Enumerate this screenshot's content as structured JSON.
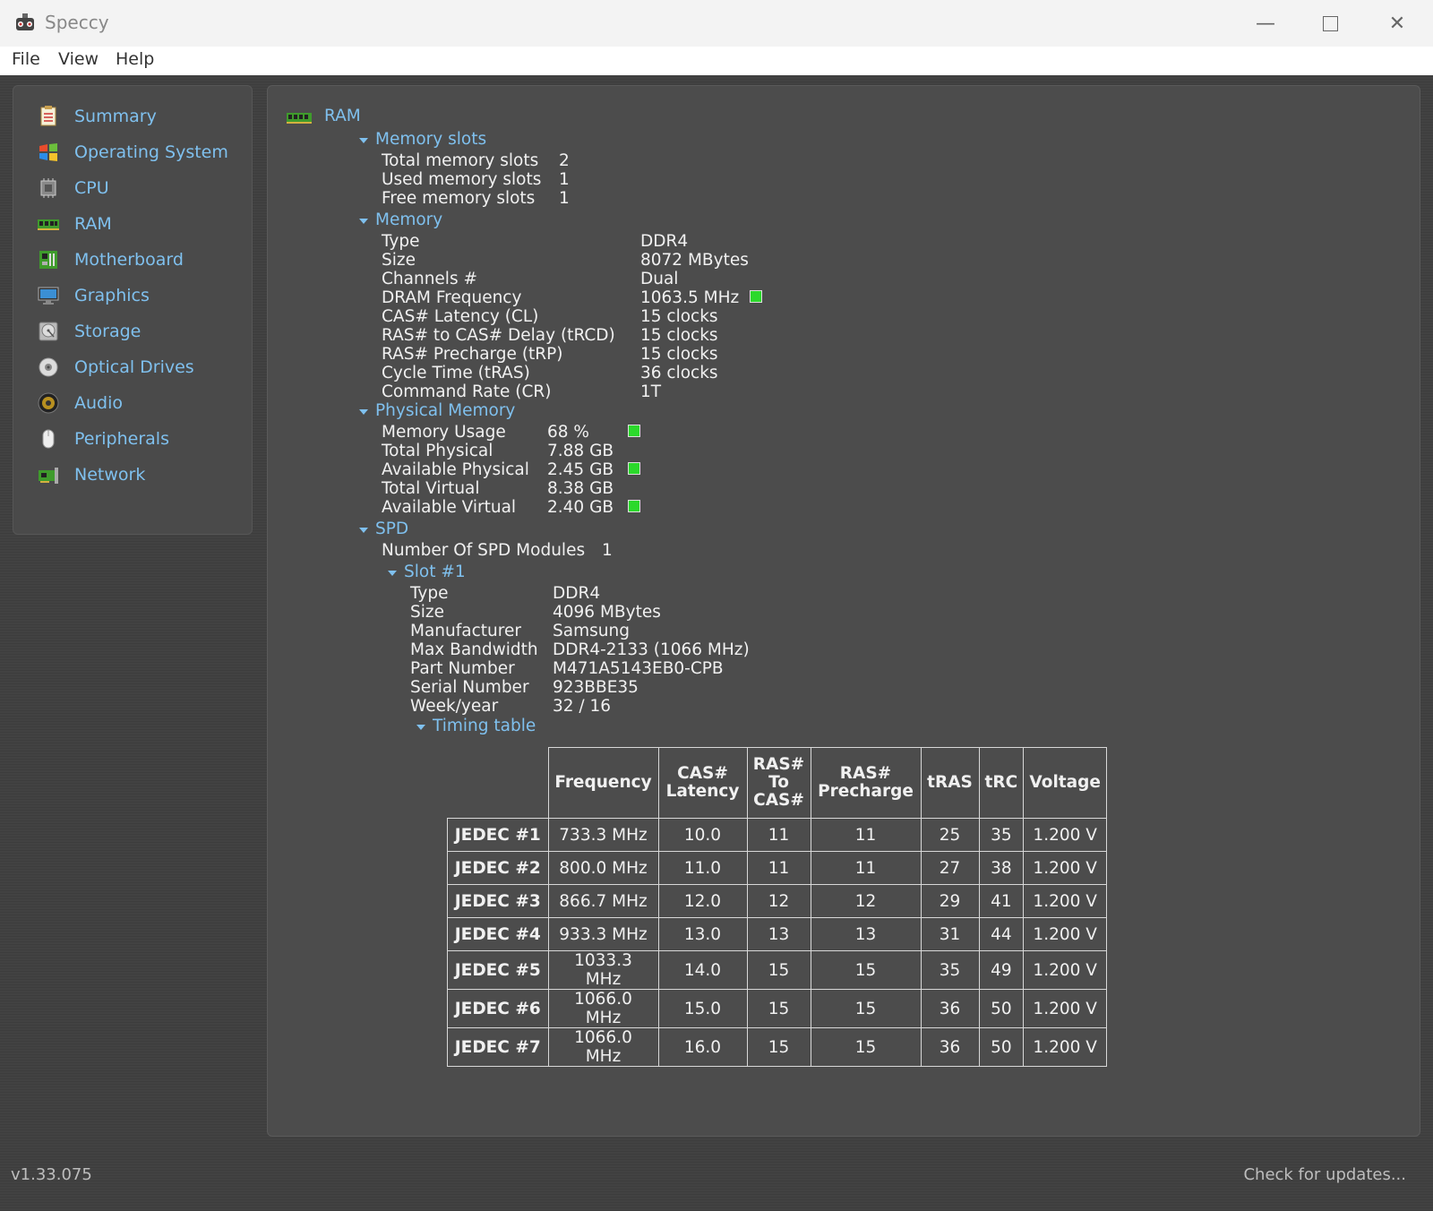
{
  "window": {
    "title": "Speccy"
  },
  "menu": [
    "File",
    "View",
    "Help"
  ],
  "sidebar": {
    "items": [
      {
        "label": "Summary",
        "icon": "summary-icon"
      },
      {
        "label": "Operating System",
        "icon": "windows-icon"
      },
      {
        "label": "CPU",
        "icon": "cpu-icon"
      },
      {
        "label": "RAM",
        "icon": "ram-icon"
      },
      {
        "label": "Motherboard",
        "icon": "motherboard-icon"
      },
      {
        "label": "Graphics",
        "icon": "monitor-icon"
      },
      {
        "label": "Storage",
        "icon": "hard-drive-icon"
      },
      {
        "label": "Optical Drives",
        "icon": "disc-icon"
      },
      {
        "label": "Audio",
        "icon": "speaker-icon"
      },
      {
        "label": "Peripherals",
        "icon": "mouse-icon"
      },
      {
        "label": "Network",
        "icon": "network-icon"
      }
    ]
  },
  "content": {
    "section_title": "RAM",
    "memory_slots": {
      "heading": "Memory slots",
      "rows": [
        {
          "label": "Total memory slots",
          "value": "2"
        },
        {
          "label": "Used memory slots",
          "value": "1"
        },
        {
          "label": "Free memory slots",
          "value": "1"
        }
      ]
    },
    "memory": {
      "heading": "Memory",
      "rows": [
        {
          "label": "Type",
          "value": "DDR4"
        },
        {
          "label": "Size",
          "value": "8072 MBytes"
        },
        {
          "label": "Channels #",
          "value": "Dual"
        },
        {
          "label": "DRAM Frequency",
          "value": "1063.5 MHz"
        },
        {
          "label": "CAS# Latency (CL)",
          "value": "15 clocks"
        },
        {
          "label": "RAS# to CAS# Delay (tRCD)",
          "value": "15 clocks"
        },
        {
          "label": "RAS# Precharge (tRP)",
          "value": "15 clocks"
        },
        {
          "label": "Cycle Time (tRAS)",
          "value": "36 clocks"
        },
        {
          "label": "Command Rate (CR)",
          "value": "1T"
        }
      ]
    },
    "physical_memory": {
      "heading": "Physical Memory",
      "rows": [
        {
          "label": "Memory Usage",
          "value": "68 %"
        },
        {
          "label": "Total Physical",
          "value": "7.88 GB"
        },
        {
          "label": "Available Physical",
          "value": "2.45 GB"
        },
        {
          "label": "Total Virtual",
          "value": "8.38 GB"
        },
        {
          "label": "Available Virtual",
          "value": "2.40 GB"
        }
      ]
    },
    "spd": {
      "heading": "SPD",
      "modules_label": "Number Of SPD Modules",
      "modules_value": "1",
      "slot_heading": "Slot #1",
      "slot_rows": [
        {
          "label": "Type",
          "value": "DDR4"
        },
        {
          "label": "Size",
          "value": "4096 MBytes"
        },
        {
          "label": "Manufacturer",
          "value": "Samsung"
        },
        {
          "label": "Max Bandwidth",
          "value": "DDR4-2133 (1066 MHz)"
        },
        {
          "label": "Part Number",
          "value": "M471A5143EB0-CPB"
        },
        {
          "label": "Serial Number",
          "value": "923BBE35"
        },
        {
          "label": "Week/year",
          "value": "32 / 16"
        }
      ],
      "timing_heading": "Timing table",
      "timing_columns": [
        "Frequency",
        "CAS#\nLatency",
        "RAS#\nTo\nCAS#",
        "RAS#\nPrecharge",
        "tRAS",
        "tRC",
        "Voltage"
      ],
      "timing_rows": [
        [
          "JEDEC #1",
          "733.3 MHz",
          "10.0",
          "11",
          "11",
          "25",
          "35",
          "1.200 V"
        ],
        [
          "JEDEC #2",
          "800.0 MHz",
          "11.0",
          "11",
          "11",
          "27",
          "38",
          "1.200 V"
        ],
        [
          "JEDEC #3",
          "866.7 MHz",
          "12.0",
          "12",
          "12",
          "29",
          "41",
          "1.200 V"
        ],
        [
          "JEDEC #4",
          "933.3 MHz",
          "13.0",
          "13",
          "13",
          "31",
          "44",
          "1.200 V"
        ],
        [
          "JEDEC #5",
          "1033.3 MHz",
          "14.0",
          "15",
          "15",
          "35",
          "49",
          "1.200 V"
        ],
        [
          "JEDEC #6",
          "1066.0 MHz",
          "15.0",
          "15",
          "15",
          "36",
          "50",
          "1.200 V"
        ],
        [
          "JEDEC #7",
          "1066.0 MHz",
          "16.0",
          "15",
          "15",
          "36",
          "50",
          "1.200 V"
        ]
      ]
    }
  },
  "status": {
    "version": "v1.33.075",
    "updates_link": "Check for updates..."
  },
  "colors": {
    "link": "#7fc0ee",
    "indicator": "#2bd92b",
    "background": "#4c4c4c"
  }
}
